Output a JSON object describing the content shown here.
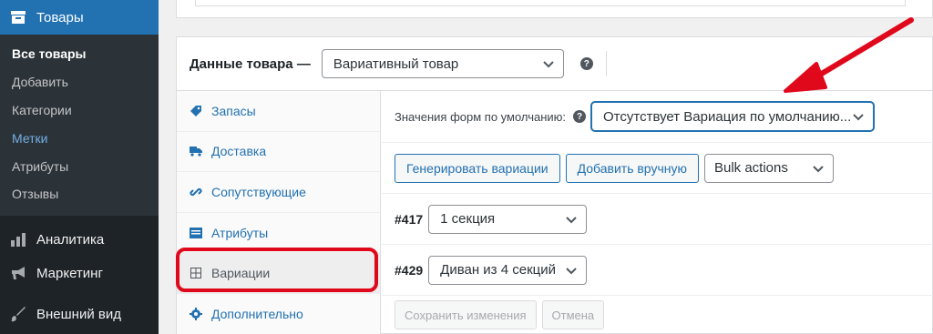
{
  "sidebar": {
    "top": {
      "label": "Товары",
      "icon": "archive-icon"
    },
    "submenu": [
      {
        "label": "Все товары"
      },
      {
        "label": "Добавить"
      },
      {
        "label": "Категории"
      },
      {
        "label": "Метки"
      },
      {
        "label": "Атрибуты"
      },
      {
        "label": "Отзывы"
      }
    ],
    "items": [
      {
        "label": "Аналитика",
        "icon": "bar-chart-icon"
      },
      {
        "label": "Маркетинг",
        "icon": "megaphone-icon"
      },
      {
        "label": "Внешний вид",
        "icon": "paintbrush-icon"
      }
    ]
  },
  "product_data": {
    "label": "Данные товара —",
    "type_select": "Вариативный товар",
    "help": "?"
  },
  "tabs": [
    {
      "label": "Запасы",
      "icon": "tag-icon"
    },
    {
      "label": "Доставка",
      "icon": "truck-icon"
    },
    {
      "label": "Сопутствующие",
      "icon": "link-icon"
    },
    {
      "label": "Атрибуты",
      "icon": "list-icon"
    },
    {
      "label": "Вариации",
      "icon": "grid-icon"
    },
    {
      "label": "Дополнительно",
      "icon": "gear-icon"
    }
  ],
  "variations": {
    "default_label": "Значения форм по умолчанию:",
    "default_select": "Отсутствует Вариация по умолчанию...",
    "buttons": {
      "generate": "Генерировать вариации",
      "add_manual": "Добавить вручную",
      "bulk": "Bulk actions"
    },
    "rows": [
      {
        "id": "#417",
        "value": "1 секция"
      },
      {
        "id": "#429",
        "value": "Диван из 4 секций"
      }
    ],
    "save": "Сохранить изменения",
    "cancel": "Отмена"
  },
  "colors": {
    "accent": "#2271b1",
    "sidebar": "#1d2327",
    "annotation": "#e0081b"
  }
}
